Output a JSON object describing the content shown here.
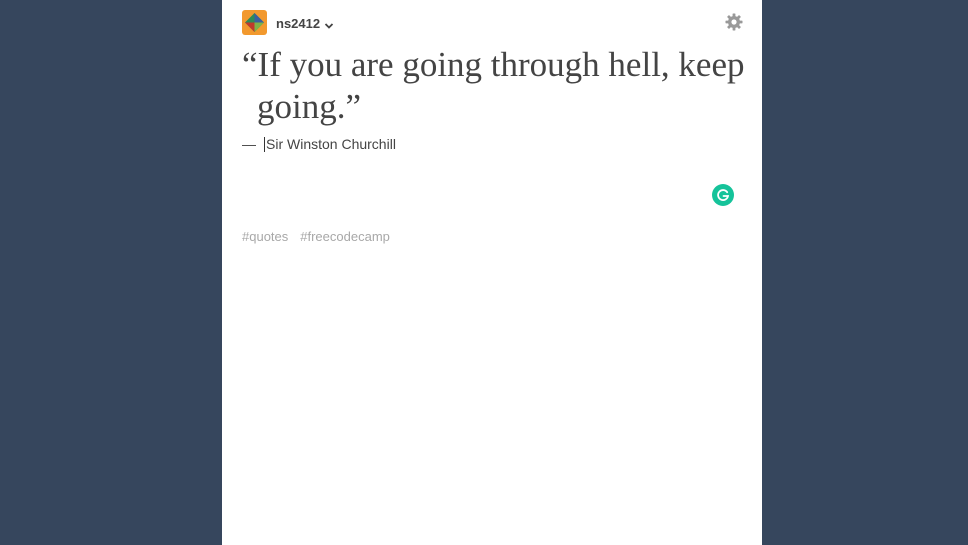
{
  "header": {
    "blog_name": "ns2412",
    "avatar_color": "#f2992e",
    "icons": [
      "avatar-icon",
      "chevron-down-icon",
      "gear-icon"
    ]
  },
  "post": {
    "quote_open": "“",
    "quote_text": "If you are going through hell, keep going.",
    "quote_close": "”",
    "source_dash": "—",
    "source_text": "Sir Winston Churchill"
  },
  "grammarly": {
    "icon": "grammarly-icon",
    "color": "#15c39a"
  },
  "tags": [
    "#quotes",
    "#freecodecamp"
  ],
  "colors": {
    "background": "#36465d",
    "panel": "#ffffff",
    "text": "#444444",
    "tag_text": "#a8a8a8"
  }
}
